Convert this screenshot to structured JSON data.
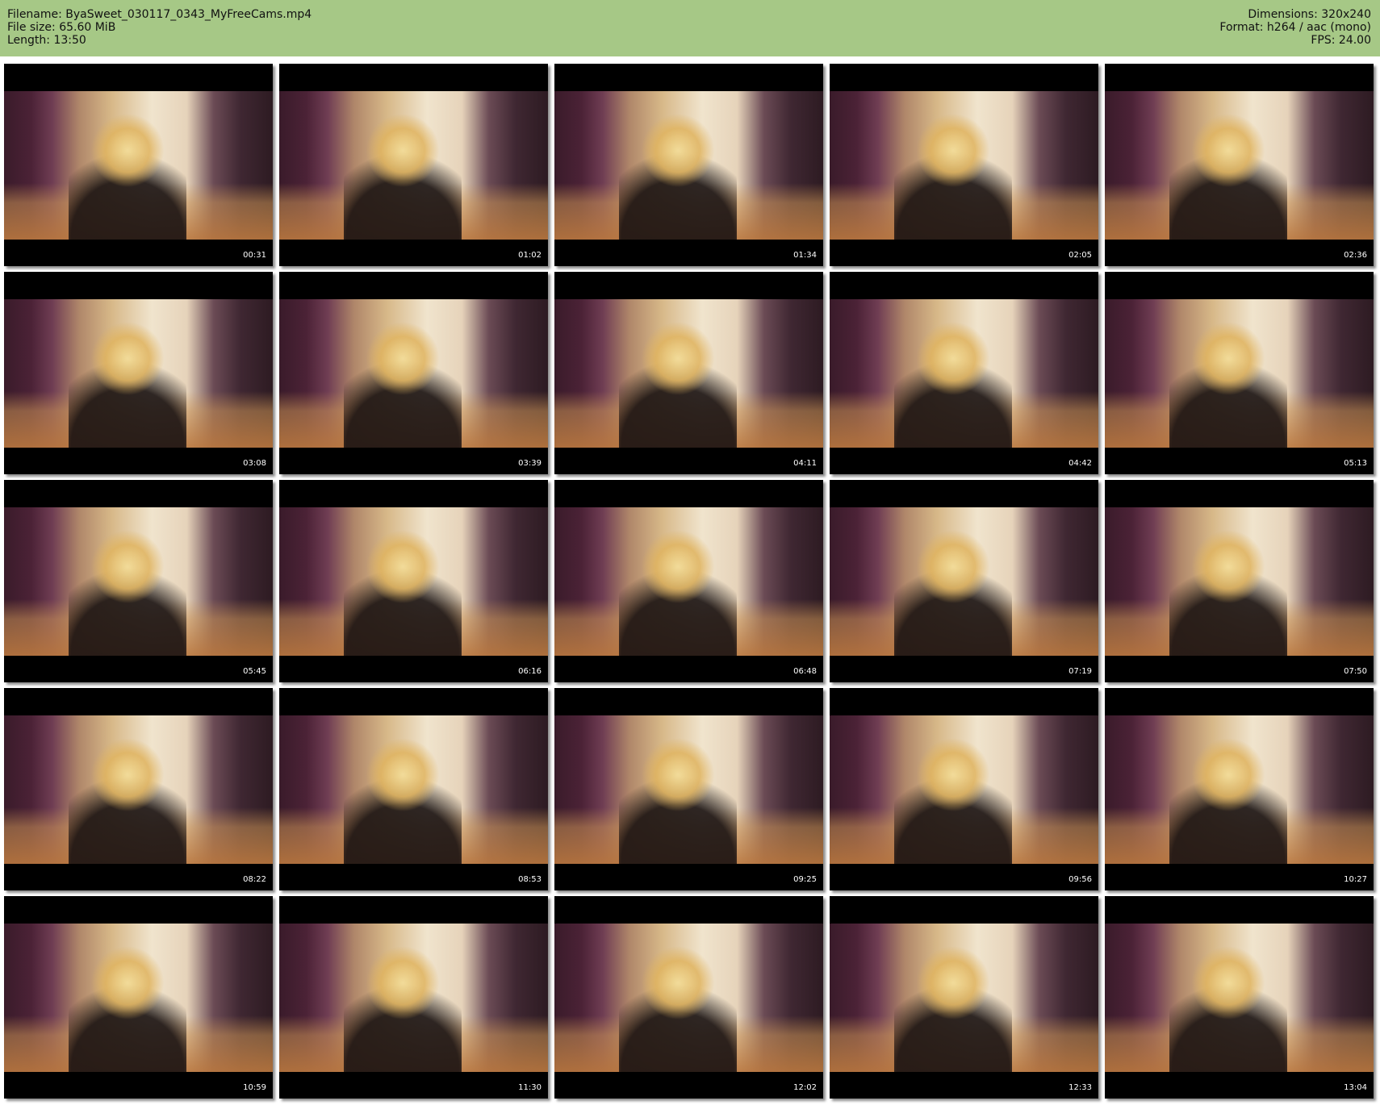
{
  "header": {
    "filename_line": "Filename: ByaSweet_030117_0343_MyFreeCams.mp4",
    "filesize_line": "File size: 65.60 MiB",
    "length_line": "Length: 13:50",
    "dimensions_line": "Dimensions: 320x240",
    "format_line": "Format: h264 / aac (mono)",
    "fps_line": "FPS: 24.00"
  },
  "thumbnails": [
    {
      "timestamp": "00:31"
    },
    {
      "timestamp": "01:02"
    },
    {
      "timestamp": "01:34"
    },
    {
      "timestamp": "02:05"
    },
    {
      "timestamp": "02:36"
    },
    {
      "timestamp": "03:08"
    },
    {
      "timestamp": "03:39"
    },
    {
      "timestamp": "04:11"
    },
    {
      "timestamp": "04:42"
    },
    {
      "timestamp": "05:13"
    },
    {
      "timestamp": "05:45"
    },
    {
      "timestamp": "06:16"
    },
    {
      "timestamp": "06:48"
    },
    {
      "timestamp": "07:19"
    },
    {
      "timestamp": "07:50"
    },
    {
      "timestamp": "08:22"
    },
    {
      "timestamp": "08:53"
    },
    {
      "timestamp": "09:25"
    },
    {
      "timestamp": "09:56"
    },
    {
      "timestamp": "10:27"
    },
    {
      "timestamp": "10:59"
    },
    {
      "timestamp": "11:30"
    },
    {
      "timestamp": "12:02"
    },
    {
      "timestamp": "12:33"
    },
    {
      "timestamp": "13:04"
    }
  ],
  "colors": {
    "header_bg": "#a6c886",
    "thumb_border": "#000000",
    "timestamp_text": "#ffffff"
  }
}
